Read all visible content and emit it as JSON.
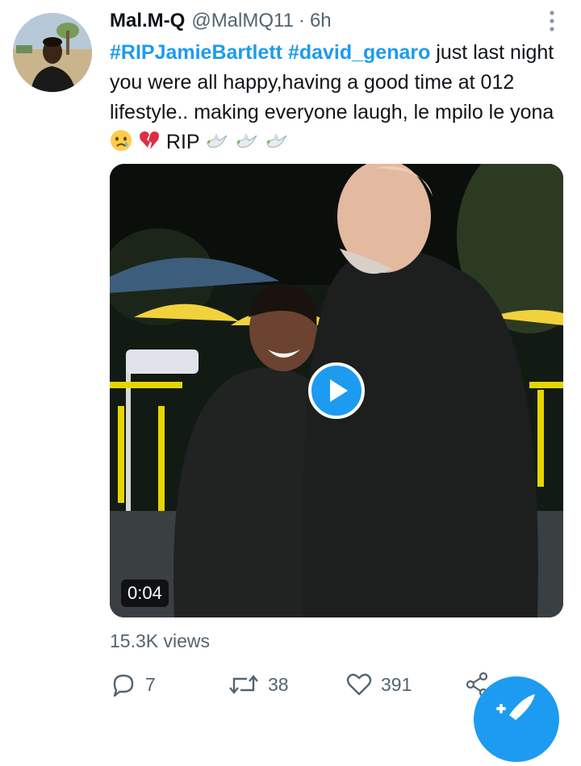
{
  "tweet": {
    "display_name": "Mal.M-Q",
    "handle": "@MalMQ11",
    "separator": "·",
    "time": "6h",
    "hashtag1": "#RIPJamieBartlett",
    "hashtag2": "#david_genaro",
    "text_part1": "just last night you were all happy,having a good time at 012 lifestyle.. making everyone laugh, le mpilo le yona",
    "text_part2": "RIP",
    "emojis": [
      "crying-face-emoji",
      "broken-heart-emoji",
      "dove-emoji"
    ]
  },
  "media": {
    "duration": "0:04",
    "play_icon": "play-icon"
  },
  "views": "15.3K views",
  "actions": {
    "reply_count": "7",
    "retweet_count": "38",
    "like_count": "391"
  },
  "colors": {
    "accent": "#1d9bf0",
    "text": "#0f1419",
    "muted": "#536471"
  }
}
